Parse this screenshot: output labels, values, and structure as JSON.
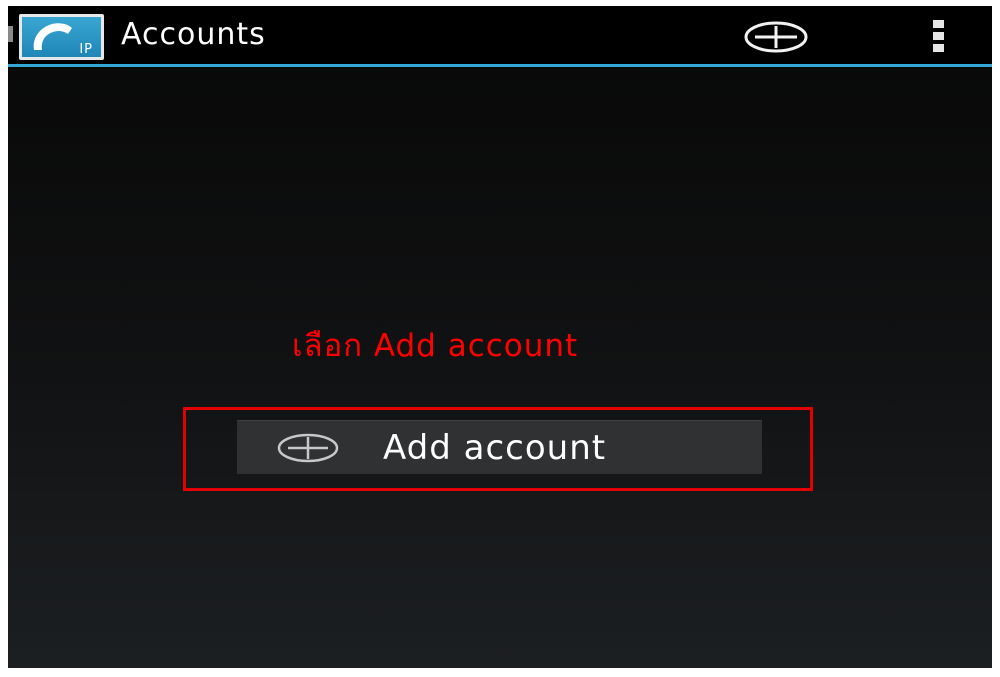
{
  "action_bar": {
    "title": "Accounts",
    "app_icon": {
      "icon": "ip-phone-app-icon",
      "badge_text": "IP"
    },
    "actions": [
      {
        "icon": "add-circle-icon",
        "label": "Add"
      },
      {
        "icon": "overflow-menu-icon",
        "label": "More options"
      }
    ],
    "divider_color": "#33a8d6"
  },
  "annotation": {
    "text": "เลือก Add account",
    "color": "#ff0000"
  },
  "main": {
    "add_account_button": {
      "icon": "add-circle-icon",
      "label": "Add account"
    }
  }
}
